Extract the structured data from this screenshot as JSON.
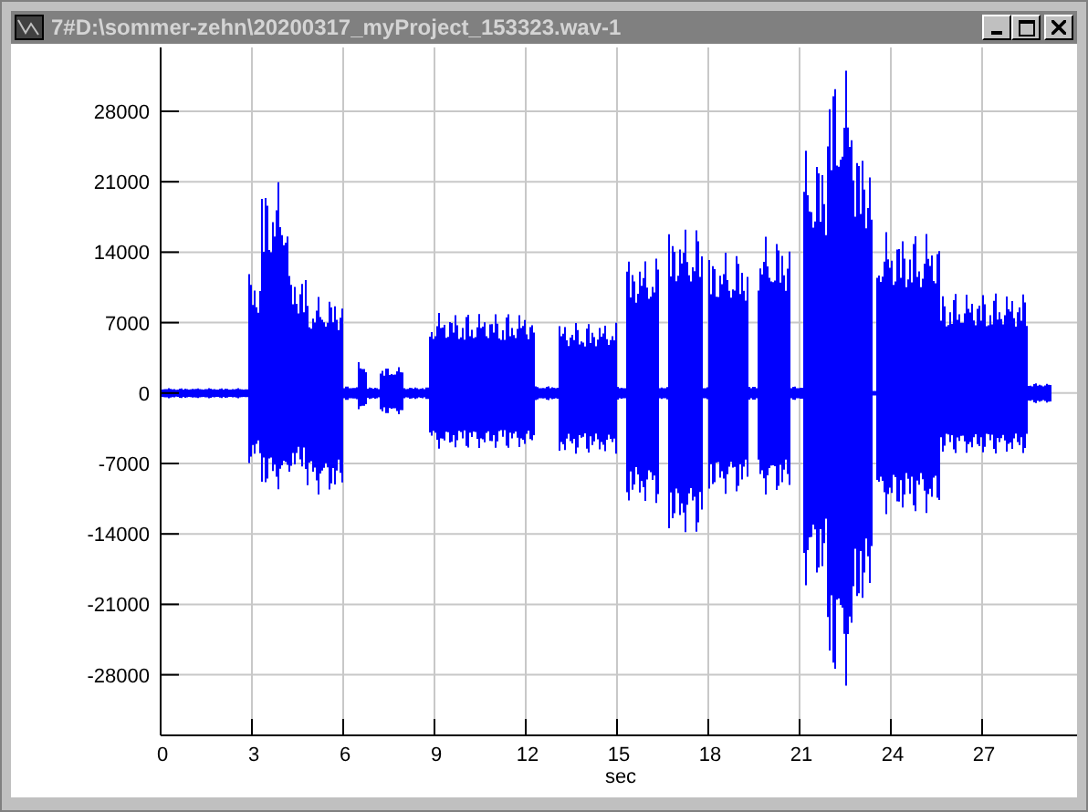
{
  "window": {
    "title": "7#D:\\sommer-zehn\\20200317_myProject_153323.wav-1"
  },
  "plot": {
    "y_ticks": [
      "28000",
      "21000",
      "14000",
      "7000",
      "0",
      "-7000",
      "-14000",
      "-21000",
      "-28000"
    ],
    "x_ticks": [
      "0",
      "3",
      "6",
      "9",
      "12",
      "15",
      "18",
      "21",
      "24",
      "27"
    ],
    "x_label": "sec"
  }
}
